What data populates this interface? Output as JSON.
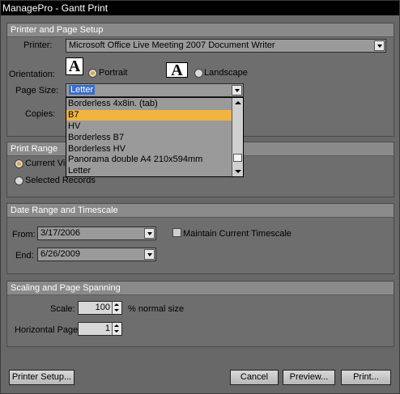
{
  "window": {
    "title": "ManagePro - Gantt Print"
  },
  "printer_setup": {
    "header": "Printer and Page Setup",
    "printer_label": "Printer:",
    "printer_value": "Microsoft Office Live Meeting 2007 Document Writer",
    "orientation_label": "Orientation:",
    "portrait_label": "Portrait",
    "landscape_label": "Landscape",
    "orientation_icon_glyph": "A",
    "orientation_selected": "Portrait",
    "pagesize_label": "Page Size:",
    "pagesize_value": "Letter",
    "copies_label": "Copies:",
    "pagesize_options": [
      "Borderless 4x8in. (tab)",
      "B7",
      "HV",
      "Borderless B7",
      "Borderless HV",
      "Panorama double A4 210x594mm",
      "Letter"
    ],
    "pagesize_highlighted": "B7"
  },
  "print_range": {
    "header": "Print Range",
    "current_view_label": "Current View",
    "selected_records_label": "Selected Records"
  },
  "date_range": {
    "header": "Date Range and Timescale",
    "from_label": "From:",
    "from_value": "3/17/2006",
    "end_label": "End:",
    "end_value": "6/26/2009",
    "maintain_label": "Maintain Current Timescale"
  },
  "scaling": {
    "header": "Scaling and Page Spanning",
    "scale_label": "Scale:",
    "scale_value": "100",
    "scale_suffix": "% normal size",
    "hpages_label": "Horizontal Pages:",
    "hpages_value": "1"
  },
  "buttons": {
    "printer_setup": "Printer Setup...",
    "cancel": "Cancel",
    "preview": "Preview...",
    "print": "Print..."
  },
  "colors": {
    "accent": "#f0b440",
    "selection": "#3a6ccc"
  }
}
